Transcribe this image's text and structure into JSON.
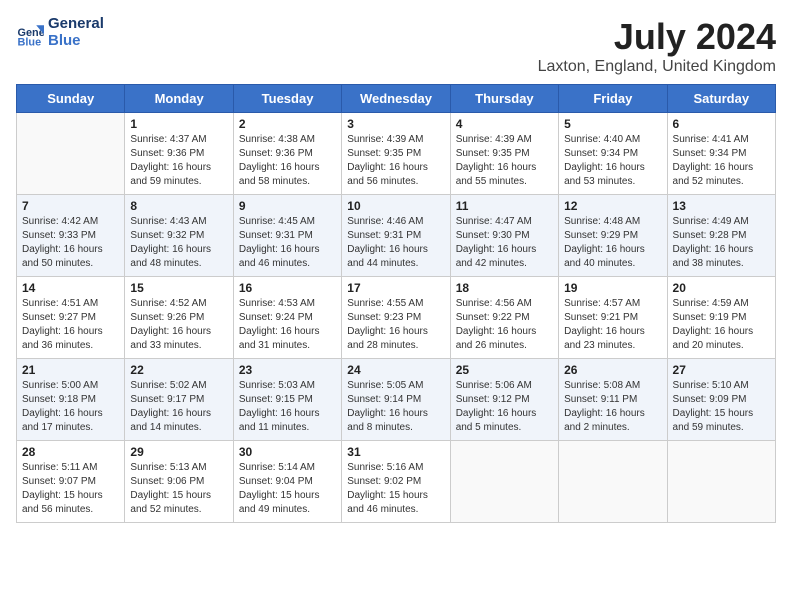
{
  "header": {
    "logo_line1": "General",
    "logo_line2": "Blue",
    "month": "July 2024",
    "location": "Laxton, England, United Kingdom"
  },
  "weekdays": [
    "Sunday",
    "Monday",
    "Tuesday",
    "Wednesday",
    "Thursday",
    "Friday",
    "Saturday"
  ],
  "weeks": [
    [
      {
        "day": "",
        "info": ""
      },
      {
        "day": "1",
        "info": "Sunrise: 4:37 AM\nSunset: 9:36 PM\nDaylight: 16 hours\nand 59 minutes."
      },
      {
        "day": "2",
        "info": "Sunrise: 4:38 AM\nSunset: 9:36 PM\nDaylight: 16 hours\nand 58 minutes."
      },
      {
        "day": "3",
        "info": "Sunrise: 4:39 AM\nSunset: 9:35 PM\nDaylight: 16 hours\nand 56 minutes."
      },
      {
        "day": "4",
        "info": "Sunrise: 4:39 AM\nSunset: 9:35 PM\nDaylight: 16 hours\nand 55 minutes."
      },
      {
        "day": "5",
        "info": "Sunrise: 4:40 AM\nSunset: 9:34 PM\nDaylight: 16 hours\nand 53 minutes."
      },
      {
        "day": "6",
        "info": "Sunrise: 4:41 AM\nSunset: 9:34 PM\nDaylight: 16 hours\nand 52 minutes."
      }
    ],
    [
      {
        "day": "7",
        "info": "Sunrise: 4:42 AM\nSunset: 9:33 PM\nDaylight: 16 hours\nand 50 minutes."
      },
      {
        "day": "8",
        "info": "Sunrise: 4:43 AM\nSunset: 9:32 PM\nDaylight: 16 hours\nand 48 minutes."
      },
      {
        "day": "9",
        "info": "Sunrise: 4:45 AM\nSunset: 9:31 PM\nDaylight: 16 hours\nand 46 minutes."
      },
      {
        "day": "10",
        "info": "Sunrise: 4:46 AM\nSunset: 9:31 PM\nDaylight: 16 hours\nand 44 minutes."
      },
      {
        "day": "11",
        "info": "Sunrise: 4:47 AM\nSunset: 9:30 PM\nDaylight: 16 hours\nand 42 minutes."
      },
      {
        "day": "12",
        "info": "Sunrise: 4:48 AM\nSunset: 9:29 PM\nDaylight: 16 hours\nand 40 minutes."
      },
      {
        "day": "13",
        "info": "Sunrise: 4:49 AM\nSunset: 9:28 PM\nDaylight: 16 hours\nand 38 minutes."
      }
    ],
    [
      {
        "day": "14",
        "info": "Sunrise: 4:51 AM\nSunset: 9:27 PM\nDaylight: 16 hours\nand 36 minutes."
      },
      {
        "day": "15",
        "info": "Sunrise: 4:52 AM\nSunset: 9:26 PM\nDaylight: 16 hours\nand 33 minutes."
      },
      {
        "day": "16",
        "info": "Sunrise: 4:53 AM\nSunset: 9:24 PM\nDaylight: 16 hours\nand 31 minutes."
      },
      {
        "day": "17",
        "info": "Sunrise: 4:55 AM\nSunset: 9:23 PM\nDaylight: 16 hours\nand 28 minutes."
      },
      {
        "day": "18",
        "info": "Sunrise: 4:56 AM\nSunset: 9:22 PM\nDaylight: 16 hours\nand 26 minutes."
      },
      {
        "day": "19",
        "info": "Sunrise: 4:57 AM\nSunset: 9:21 PM\nDaylight: 16 hours\nand 23 minutes."
      },
      {
        "day": "20",
        "info": "Sunrise: 4:59 AM\nSunset: 9:19 PM\nDaylight: 16 hours\nand 20 minutes."
      }
    ],
    [
      {
        "day": "21",
        "info": "Sunrise: 5:00 AM\nSunset: 9:18 PM\nDaylight: 16 hours\nand 17 minutes."
      },
      {
        "day": "22",
        "info": "Sunrise: 5:02 AM\nSunset: 9:17 PM\nDaylight: 16 hours\nand 14 minutes."
      },
      {
        "day": "23",
        "info": "Sunrise: 5:03 AM\nSunset: 9:15 PM\nDaylight: 16 hours\nand 11 minutes."
      },
      {
        "day": "24",
        "info": "Sunrise: 5:05 AM\nSunset: 9:14 PM\nDaylight: 16 hours\nand 8 minutes."
      },
      {
        "day": "25",
        "info": "Sunrise: 5:06 AM\nSunset: 9:12 PM\nDaylight: 16 hours\nand 5 minutes."
      },
      {
        "day": "26",
        "info": "Sunrise: 5:08 AM\nSunset: 9:11 PM\nDaylight: 16 hours\nand 2 minutes."
      },
      {
        "day": "27",
        "info": "Sunrise: 5:10 AM\nSunset: 9:09 PM\nDaylight: 15 hours\nand 59 minutes."
      }
    ],
    [
      {
        "day": "28",
        "info": "Sunrise: 5:11 AM\nSunset: 9:07 PM\nDaylight: 15 hours\nand 56 minutes."
      },
      {
        "day": "29",
        "info": "Sunrise: 5:13 AM\nSunset: 9:06 PM\nDaylight: 15 hours\nand 52 minutes."
      },
      {
        "day": "30",
        "info": "Sunrise: 5:14 AM\nSunset: 9:04 PM\nDaylight: 15 hours\nand 49 minutes."
      },
      {
        "day": "31",
        "info": "Sunrise: 5:16 AM\nSunset: 9:02 PM\nDaylight: 15 hours\nand 46 minutes."
      },
      {
        "day": "",
        "info": ""
      },
      {
        "day": "",
        "info": ""
      },
      {
        "day": "",
        "info": ""
      }
    ]
  ]
}
